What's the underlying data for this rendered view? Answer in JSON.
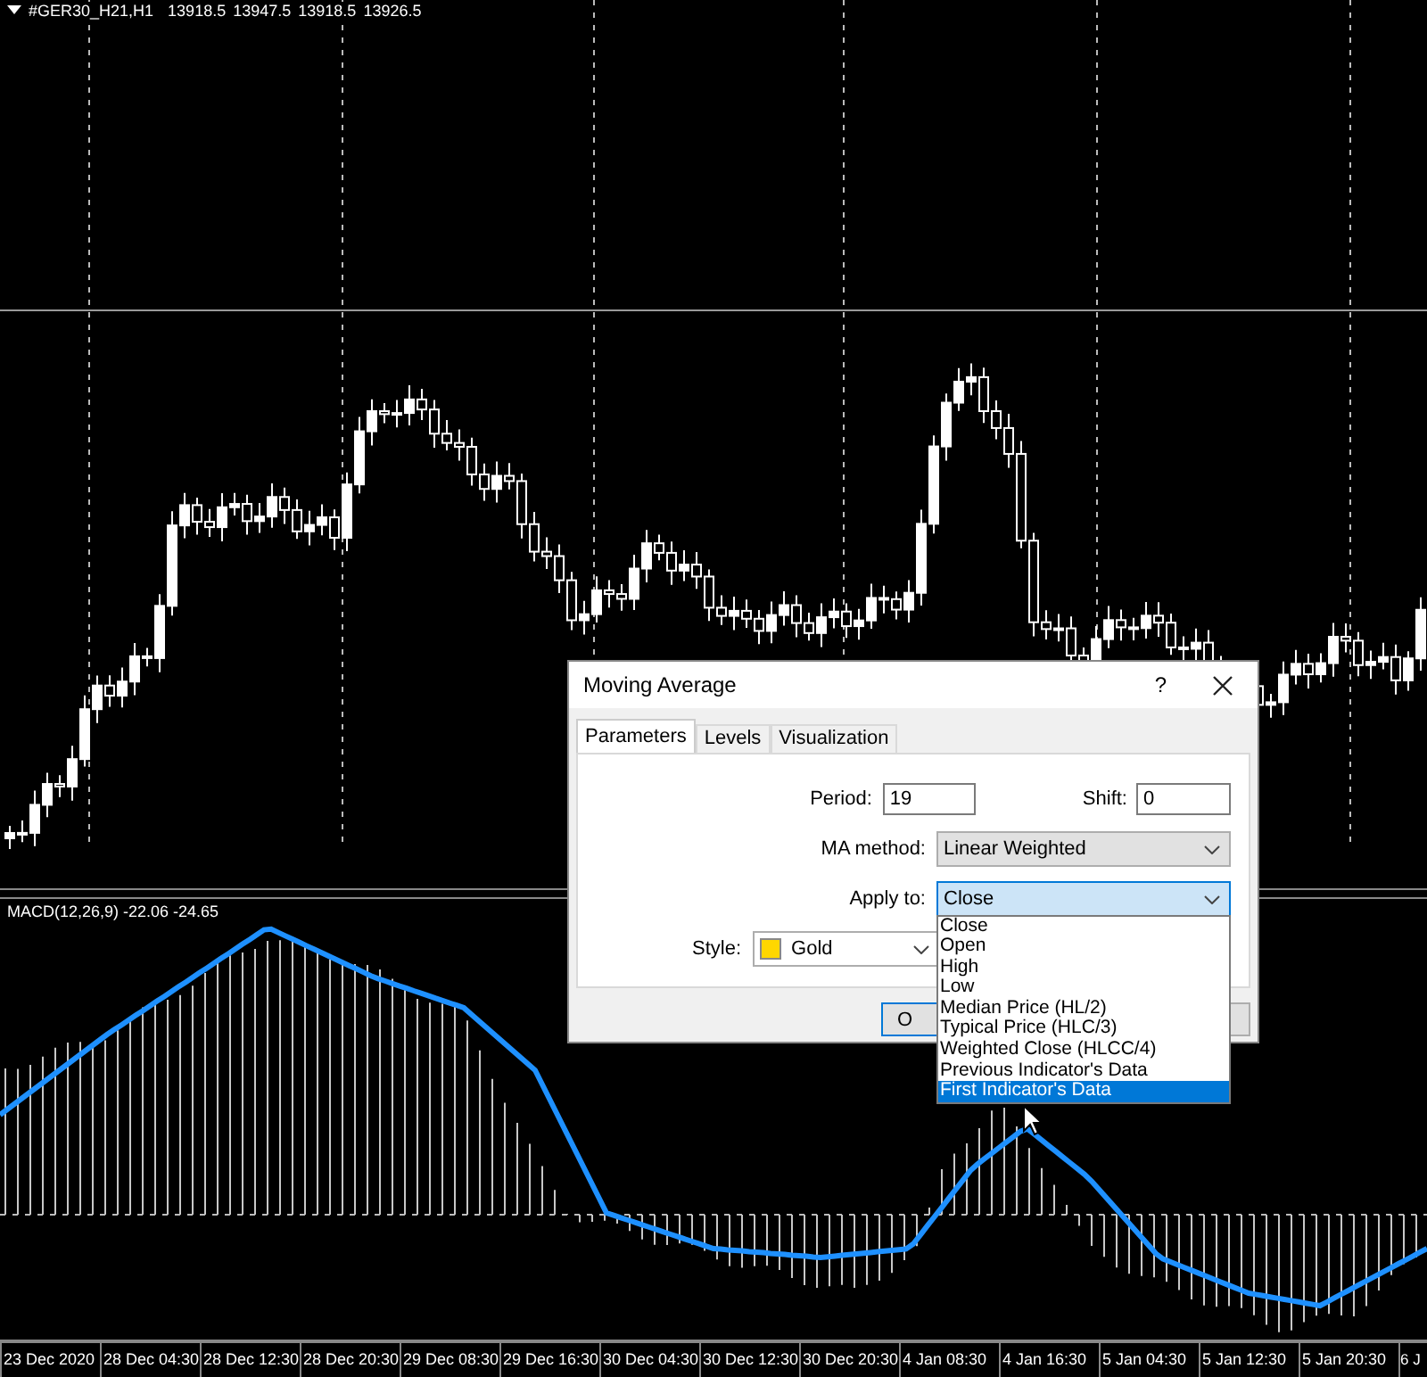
{
  "chart": {
    "symbol": "#GER30_H21,H1",
    "prices": [
      "13918.5",
      "13947.5",
      "13918.5",
      "13926.5"
    ]
  },
  "indicator_pane": {
    "label": "MACD(12,26,9) -22.06 -24.65"
  },
  "time_axis": {
    "labels": [
      "23 Dec 2020",
      "28 Dec 04:30",
      "28 Dec 12:30",
      "28 Dec 20:30",
      "29 Dec 08:30",
      "29 Dec 16:30",
      "30 Dec 04:30",
      "30 Dec 12:30",
      "30 Dec 20:30",
      "4 Jan 08:30",
      "4 Jan 16:30",
      "5 Jan 04:30",
      "5 Jan 12:30",
      "5 Jan 20:30",
      "6 J"
    ]
  },
  "dialog": {
    "title": "Moving Average",
    "help": "?",
    "tabs": [
      {
        "label": "Parameters",
        "selected": true
      },
      {
        "label": "Levels",
        "selected": false
      },
      {
        "label": "Visualization",
        "selected": false
      }
    ],
    "period": {
      "label": "Period:",
      "value": "19"
    },
    "shift": {
      "label": "Shift:",
      "value": "0"
    },
    "ma_method": {
      "label": "MA method:",
      "value": "Linear Weighted"
    },
    "apply_to": {
      "label": "Apply to:",
      "value": "Close",
      "expanded": true,
      "options": [
        {
          "label": "Close",
          "highlighted": false
        },
        {
          "label": "Open",
          "highlighted": false
        },
        {
          "label": "High",
          "highlighted": false
        },
        {
          "label": "Low",
          "highlighted": false
        },
        {
          "label": "Median Price (HL/2)",
          "highlighted": false
        },
        {
          "label": "Typical Price (HLC/3)",
          "highlighted": false
        },
        {
          "label": "Weighted Close (HLCC/4)",
          "highlighted": false
        },
        {
          "label": "Previous Indicator's Data",
          "highlighted": false
        },
        {
          "label": "First Indicator's Data",
          "highlighted": true
        }
      ]
    },
    "style": {
      "label": "Style:",
      "value": "Gold",
      "color": "#ffd700"
    },
    "buttons": [
      "O"
    ]
  }
}
